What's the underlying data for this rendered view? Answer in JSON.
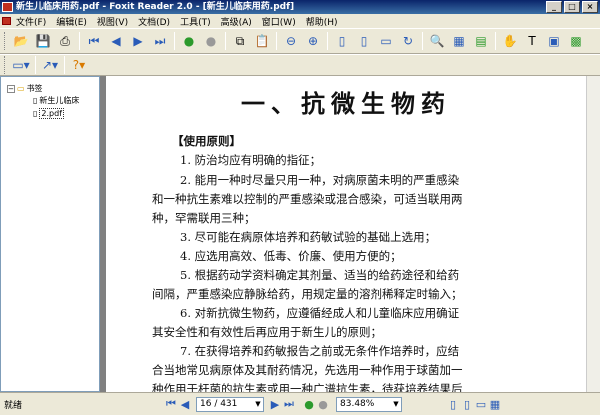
{
  "title": "新生儿临床用药.pdf - Foxit Reader 2.0 - [新生儿临床用药.pdf]",
  "menu": [
    "文件(F)",
    "编辑(E)",
    "视图(V)",
    "文档(D)",
    "工具(T)",
    "高级(A)",
    "窗口(W)",
    "帮助(H)"
  ],
  "sidebar": {
    "root": "书签",
    "items": [
      "新生儿临床",
      "2.pdf"
    ]
  },
  "page": {
    "heading": "一、抗微生物药",
    "section": "【使用原则】",
    "lines": [
      "1. 防治均应有明确的指征；",
      "2. 能用一种时尽量只用一种，对病原菌未明的严重感染",
      "和一种抗生素难以控制的严重感染或混合感染，可适当联用两",
      "种，罕需联用三种；",
      "3. 尽可能在病原体培养和药敏试验的基础上选用；",
      "4. 应选用高效、低毒、价廉、使用方便的；",
      "5. 根据药动学资料确定其剂量、适当的给药途径和给药",
      "间隔，严重感染应静脉给药，用规定量的溶剂稀释定时输入；",
      "6. 对新抗微生物药，应遵循经成人和儿童临床应用确证",
      "其安全性和有效性后再应用于新生儿的原则；",
      "7. 在获得培养和药敏报告之前或无条件作培养时，应结",
      "合当地常见病原体及其耐药情况，先选用一种作用于球菌加一",
      "种作用于杆菌的抗生素或用一种广谱抗生素，待获培养结果后"
    ]
  },
  "status": {
    "text": "就绪",
    "page": "16 / 431",
    "zoom": "83.48%"
  }
}
